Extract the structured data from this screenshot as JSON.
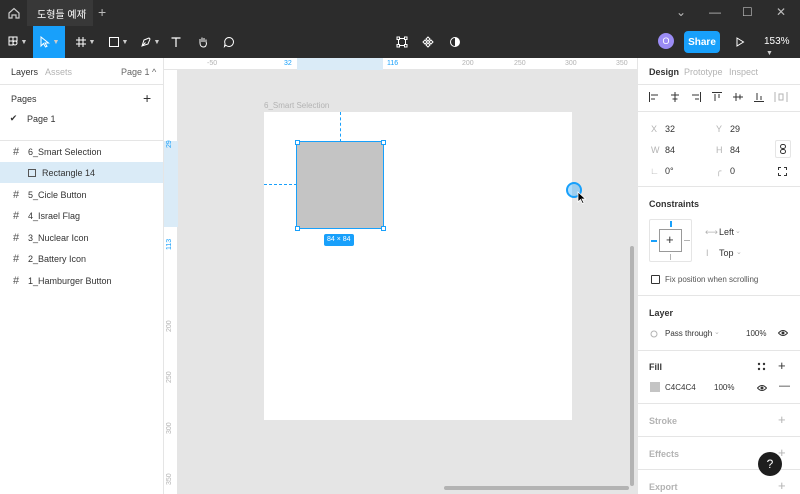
{
  "window": {
    "tab_title": "도형들 예제",
    "tab_close": "×",
    "new_tab": "+",
    "controls": [
      "⌄",
      "—",
      "☐",
      "✕"
    ]
  },
  "toolbar": {
    "share_label": "Share",
    "zoom_label": "153%",
    "avatar_initial": "O",
    "accent": "#18a0fb"
  },
  "left_panel": {
    "tabs": [
      "Layers",
      "Assets"
    ],
    "page_selector": "Page 1 ^",
    "pages_title": "Pages",
    "pages": [
      "Page 1"
    ],
    "layers": [
      {
        "name": "6_Smart Selection",
        "icon": "frame-icon"
      },
      {
        "name": "Rectangle 14",
        "icon": "rectangle-icon",
        "selected": true
      },
      {
        "name": "5_Cicle Button",
        "icon": "frame-icon"
      },
      {
        "name": "4_Israel Flag",
        "icon": "frame-icon"
      },
      {
        "name": "3_Nuclear Icon",
        "icon": "frame-icon"
      },
      {
        "name": "2_Battery Icon",
        "icon": "frame-icon"
      },
      {
        "name": "1_Hamburger Button",
        "icon": "frame-icon"
      }
    ]
  },
  "rulers": {
    "h_ticks": [
      "-50",
      "32",
      "116",
      "200",
      "250",
      "300",
      "350"
    ],
    "v_ticks": [
      "29",
      "113",
      "200",
      "250",
      "300",
      "350"
    ]
  },
  "canvas": {
    "frame_label": "6_Smart Selection",
    "selection_size": "84 × 84",
    "rect_fill": "#c4c4c4"
  },
  "right_panel": {
    "tabs": [
      "Design",
      "Prototype",
      "Inspect"
    ],
    "x_label": "X",
    "x_value": "32",
    "y_label": "Y",
    "y_value": "29",
    "w_label": "W",
    "w_value": "84",
    "h_label": "H",
    "h_value": "84",
    "rotation_value": "0°",
    "radius_value": "0",
    "constraints_title": "Constraints",
    "constraint_h": "Left",
    "constraint_v": "Top",
    "fix_position_label": "Fix position when scrolling",
    "layer_title": "Layer",
    "blend_mode": "Pass through",
    "layer_opacity": "100%",
    "fill_title": "Fill",
    "fill_hex": "C4C4C4",
    "fill_opacity": "100%",
    "stroke_title": "Stroke",
    "effects_title": "Effects",
    "export_title": "Export"
  },
  "help_label": "?"
}
